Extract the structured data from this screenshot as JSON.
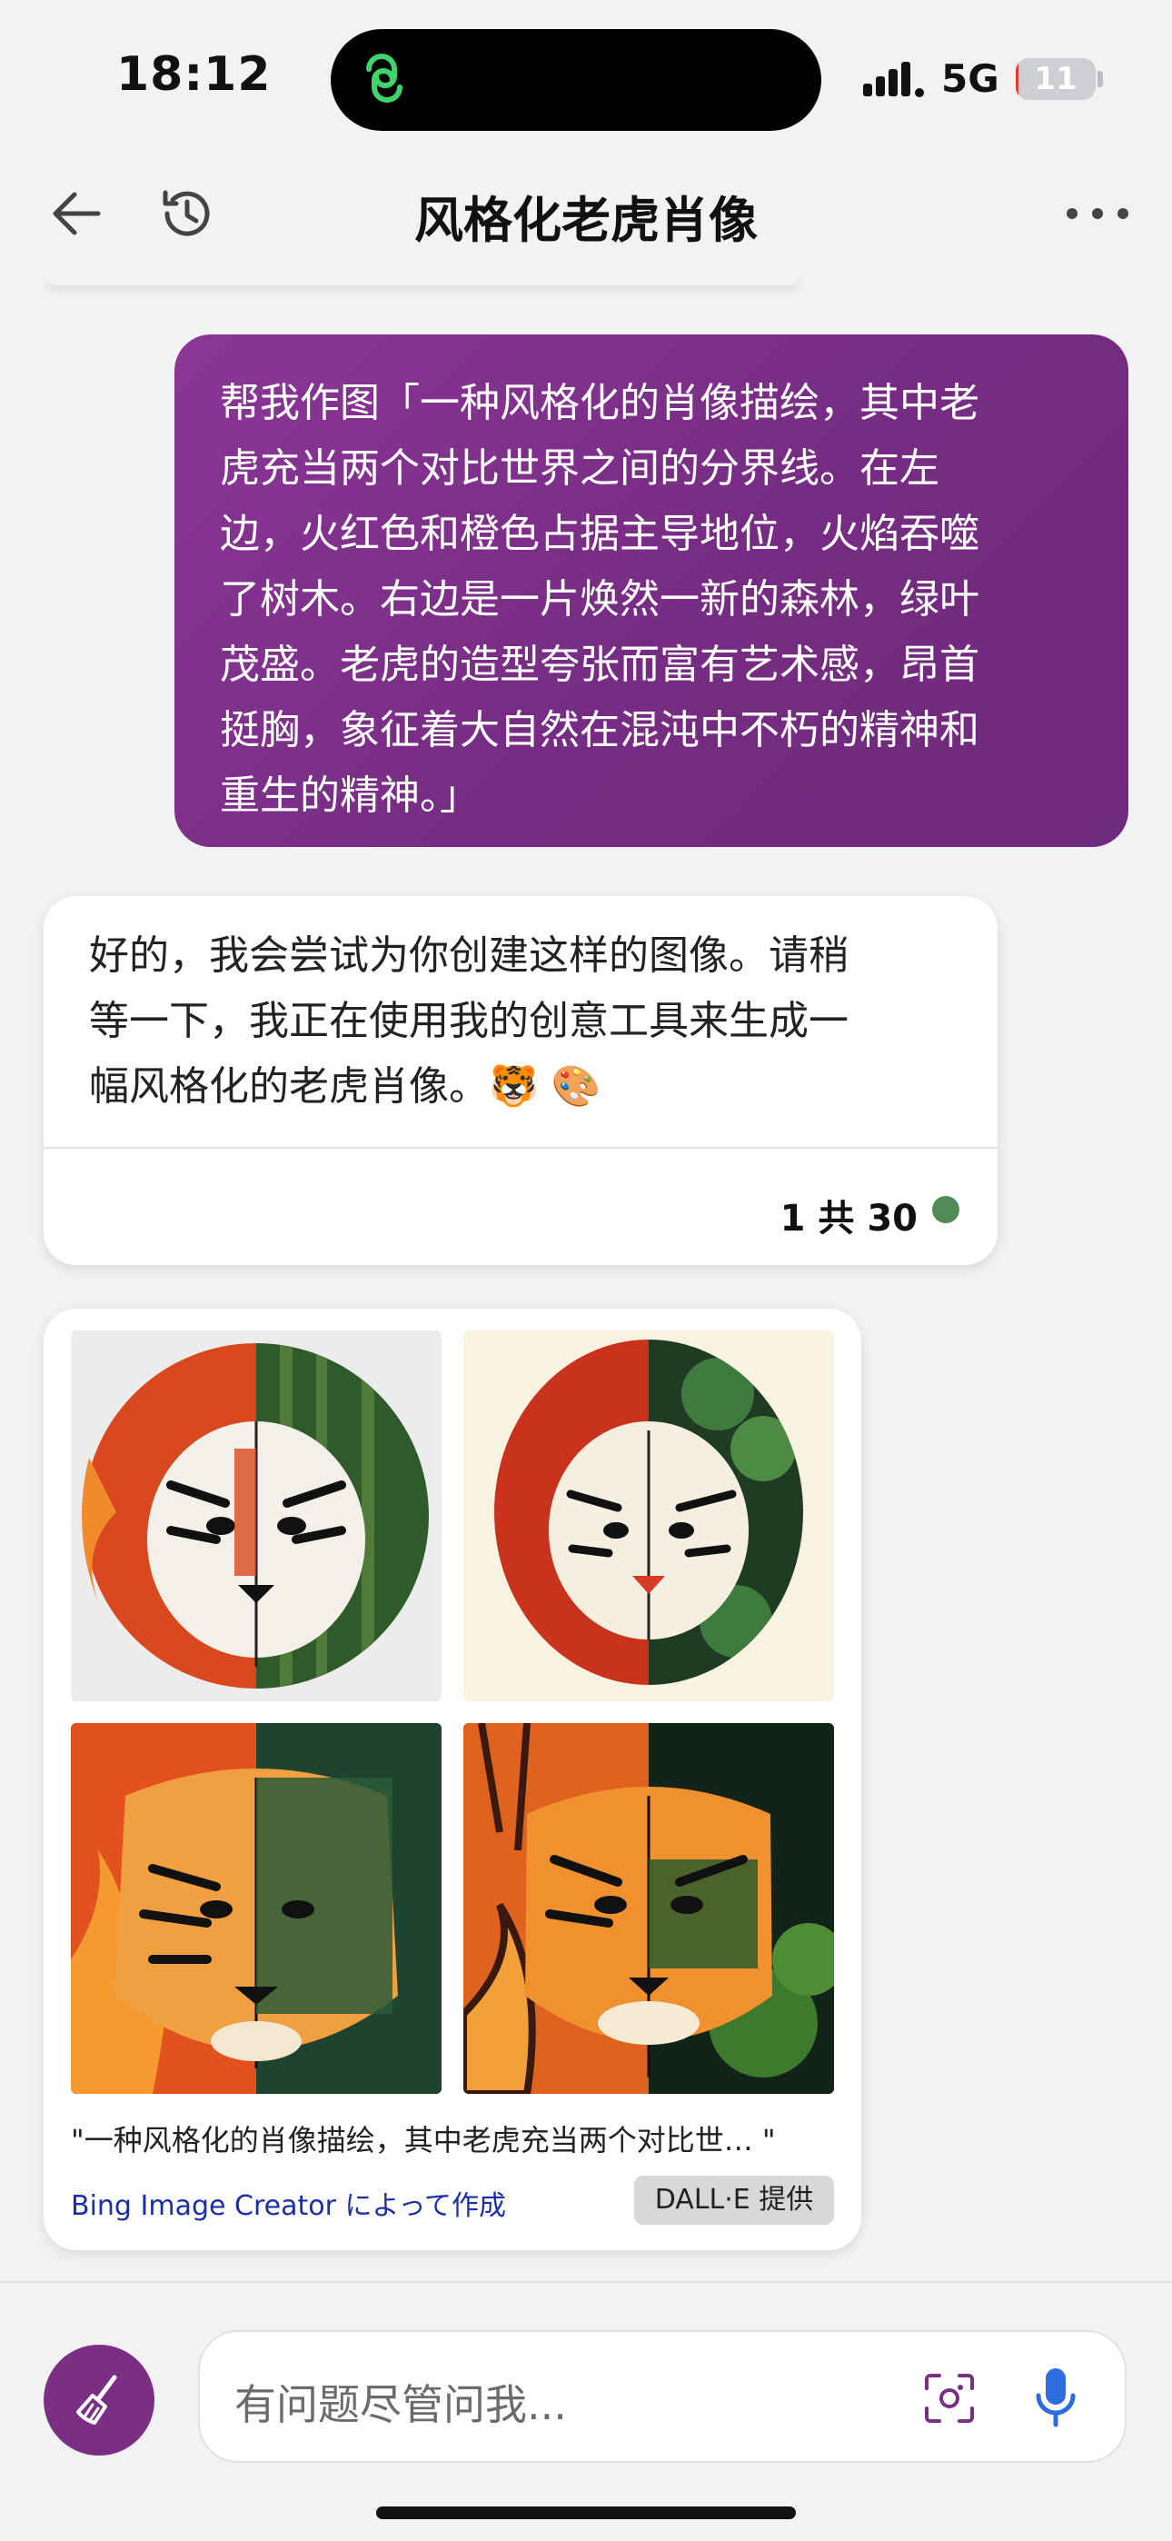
{
  "status_bar": {
    "time": "18:12",
    "network": "5G",
    "battery": "11",
    "battery_level_percent": 11
  },
  "header": {
    "title": "风格化老虎肖像"
  },
  "user_message": {
    "lines": [
      "帮我作图「一种风格化的肖像描绘，其中老",
      "虎充当两个对比世界之间的分界线。在左",
      "边，火红色和橙色占据主导地位，火焰吞噬",
      "了树木。右边是一片焕然一新的森林，绿叶",
      "茂盛。老虎的造型夸张而富有艺术感，昂首",
      "挺胸，象征着大自然在混沌中不朽的精神和",
      "重生的精神。」"
    ]
  },
  "bot_message": {
    "lines": [
      "好的，我会尝试为你创建这样的图像。请稍",
      "等一下，我正在使用我的创意工具来生成一",
      "幅风格化的老虎肖像。🐯 🎨"
    ],
    "counter": "1 共 30"
  },
  "image_card": {
    "caption": "\"一种风格化的肖像描绘，其中老虎充当两个对比世…  \"",
    "creator_link": "Bing Image Creator によって作成",
    "badge": "DALL·E 提供"
  },
  "composer": {
    "placeholder": "有问题尽管问我..."
  },
  "colors": {
    "user_bubble": "#7b2f84",
    "accent_blue": "#2f6be0",
    "status_dot": "#4f8a57"
  },
  "icons": [
    "back-arrow-icon",
    "history-icon",
    "more-icon",
    "broom-icon",
    "scan-icon",
    "microphone-icon",
    "copilot-logo-icon"
  ]
}
